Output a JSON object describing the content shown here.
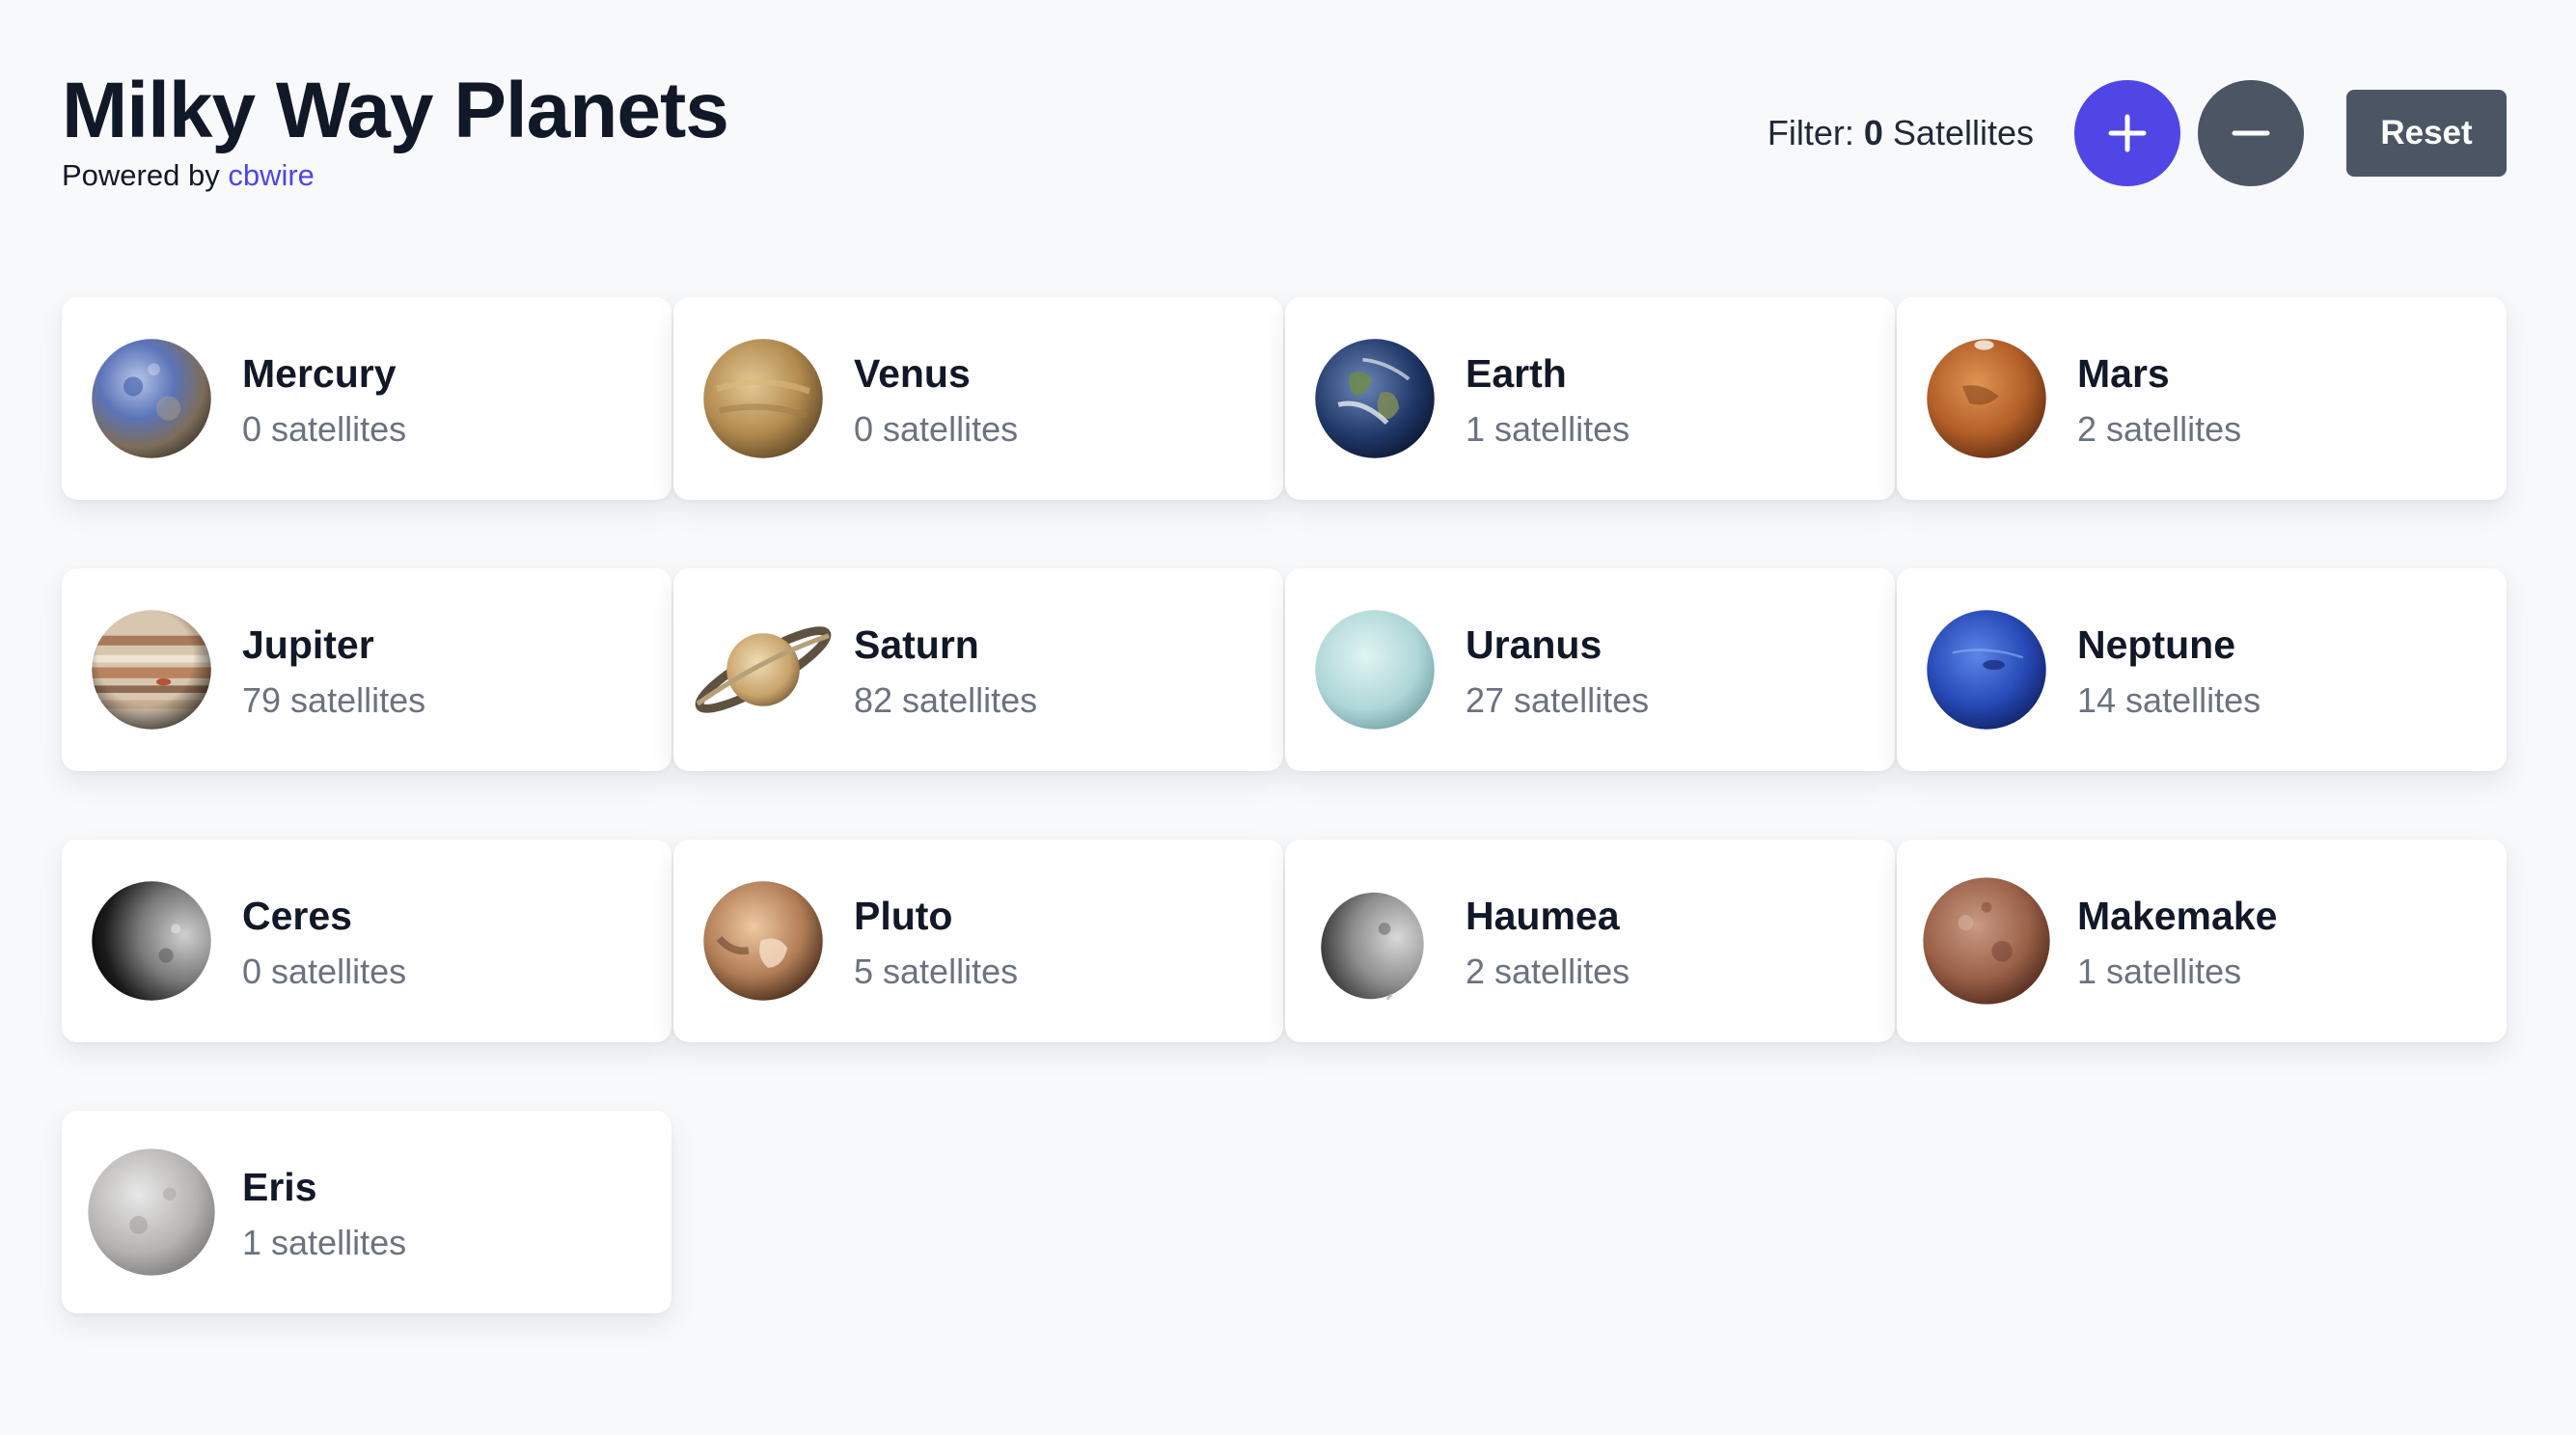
{
  "header": {
    "title": "Milky Way Planets",
    "powered_prefix": "Powered by",
    "powered_link": "cbwire"
  },
  "controls": {
    "filter_prefix": "Filter:",
    "filter_count": "0",
    "filter_suffix": "Satellites",
    "plus_icon": "plus-icon",
    "minus_icon": "minus-icon",
    "reset_label": "Reset"
  },
  "planets": [
    {
      "name": "Mercury",
      "satellites": "0 satellites",
      "icon": "mercury-icon"
    },
    {
      "name": "Venus",
      "satellites": "0 satellites",
      "icon": "venus-icon"
    },
    {
      "name": "Earth",
      "satellites": "1 satellites",
      "icon": "earth-icon"
    },
    {
      "name": "Mars",
      "satellites": "2 satellites",
      "icon": "mars-icon"
    },
    {
      "name": "Jupiter",
      "satellites": "79 satellites",
      "icon": "jupiter-icon"
    },
    {
      "name": "Saturn",
      "satellites": "82 satellites",
      "icon": "saturn-icon"
    },
    {
      "name": "Uranus",
      "satellites": "27 satellites",
      "icon": "uranus-icon"
    },
    {
      "name": "Neptune",
      "satellites": "14 satellites",
      "icon": "neptune-icon"
    },
    {
      "name": "Ceres",
      "satellites": "0 satellites",
      "icon": "ceres-icon"
    },
    {
      "name": "Pluto",
      "satellites": "5 satellites",
      "icon": "pluto-icon"
    },
    {
      "name": "Haumea",
      "satellites": "2 satellites",
      "icon": "haumea-icon"
    },
    {
      "name": "Makemake",
      "satellites": "1 satellites",
      "icon": "makemake-icon"
    },
    {
      "name": "Eris",
      "satellites": "1 satellites",
      "icon": "eris-icon"
    }
  ],
  "colors": {
    "accent": "#4f46e5",
    "secondary_button": "#4b5563",
    "background": "#f8f9fb",
    "card": "#ffffff",
    "muted_text": "#6b7280"
  }
}
